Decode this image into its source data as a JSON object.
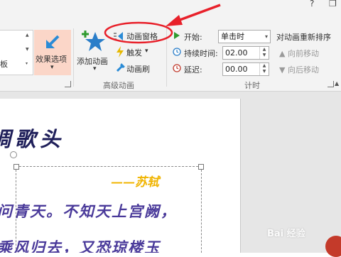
{
  "top_right": {
    "help": "?",
    "restore": "❐"
  },
  "left_group": {
    "partial_label": "板"
  },
  "effect_options": {
    "label": "效果选项",
    "dropdown": "▾"
  },
  "add_animation": {
    "label": "添加动画",
    "dropdown": "▾"
  },
  "advanced": {
    "pane_label": "动画窗格",
    "trigger_label": "触发",
    "trigger_dd": "▾",
    "painter_label": "动画刷",
    "group_label": "高级动画"
  },
  "timing": {
    "start_label": "开始:",
    "start_value": "单击时",
    "duration_label": "持续时间:",
    "duration_value": "02.00",
    "delay_label": "延迟:",
    "delay_value": "00.00",
    "group_label": "计时"
  },
  "reorder": {
    "title": "对动画重新排序",
    "earlier": "向前移动",
    "later": "向后移动"
  },
  "slide": {
    "title": "调歌头",
    "author": "——苏轼",
    "line1": "问青天。不知天上宫阙，",
    "line2": "乘风归去，又恐琼楼玉"
  },
  "watermark": "Bai 经验",
  "colors": {
    "annotation_red": "#e8202a",
    "title_navy": "#1f1f5a",
    "author_gold": "#f0b400",
    "poem_purple": "#4a3a9a",
    "accent_blue": "#2a8bd6"
  }
}
